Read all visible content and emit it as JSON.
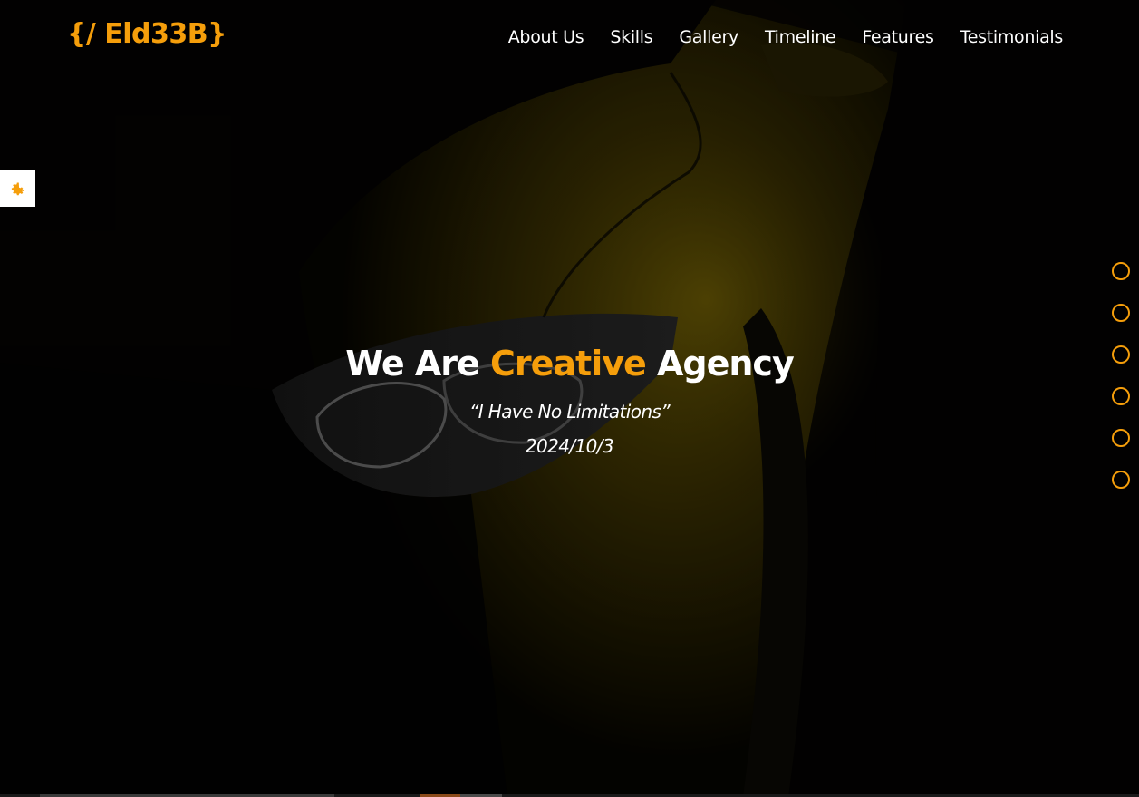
{
  "header": {
    "logo": "{/ Eld33B}",
    "nav": [
      "About Us",
      "Skills",
      "Gallery",
      "Timeline",
      "Features",
      "Testimonials"
    ]
  },
  "settings": {
    "icon": "gear-icon"
  },
  "intro": {
    "title_before": "We Are ",
    "title_accent": "Creative",
    "title_after": " Agency",
    "quote": "“I Have No Limitations”",
    "date": "2024/10/3"
  },
  "bullets_count": 6,
  "colors": {
    "accent": "#f59e0b",
    "text": "#ffffff",
    "background": "#000000"
  }
}
